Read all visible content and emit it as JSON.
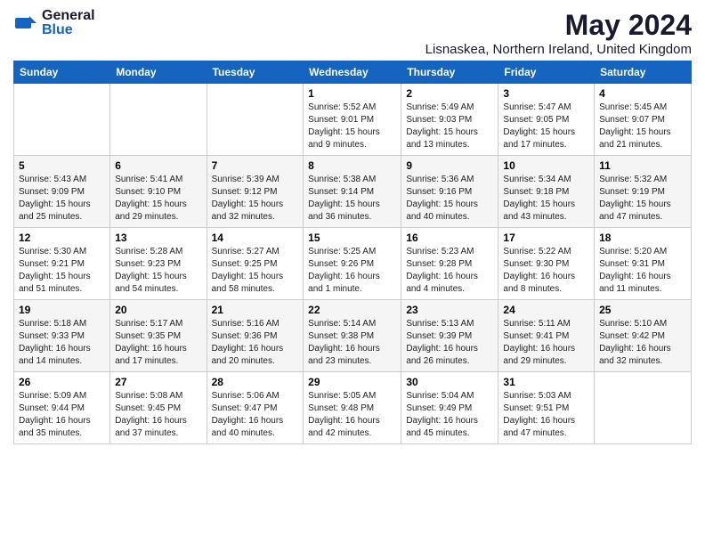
{
  "logo": {
    "general": "General",
    "blue": "Blue"
  },
  "title": "May 2024",
  "location": "Lisnaskea, Northern Ireland, United Kingdom",
  "headers": [
    "Sunday",
    "Monday",
    "Tuesday",
    "Wednesday",
    "Thursday",
    "Friday",
    "Saturday"
  ],
  "weeks": [
    [
      {
        "day": "",
        "info": ""
      },
      {
        "day": "",
        "info": ""
      },
      {
        "day": "",
        "info": ""
      },
      {
        "day": "1",
        "info": "Sunrise: 5:52 AM\nSunset: 9:01 PM\nDaylight: 15 hours\nand 9 minutes."
      },
      {
        "day": "2",
        "info": "Sunrise: 5:49 AM\nSunset: 9:03 PM\nDaylight: 15 hours\nand 13 minutes."
      },
      {
        "day": "3",
        "info": "Sunrise: 5:47 AM\nSunset: 9:05 PM\nDaylight: 15 hours\nand 17 minutes."
      },
      {
        "day": "4",
        "info": "Sunrise: 5:45 AM\nSunset: 9:07 PM\nDaylight: 15 hours\nand 21 minutes."
      }
    ],
    [
      {
        "day": "5",
        "info": "Sunrise: 5:43 AM\nSunset: 9:09 PM\nDaylight: 15 hours\nand 25 minutes."
      },
      {
        "day": "6",
        "info": "Sunrise: 5:41 AM\nSunset: 9:10 PM\nDaylight: 15 hours\nand 29 minutes."
      },
      {
        "day": "7",
        "info": "Sunrise: 5:39 AM\nSunset: 9:12 PM\nDaylight: 15 hours\nand 32 minutes."
      },
      {
        "day": "8",
        "info": "Sunrise: 5:38 AM\nSunset: 9:14 PM\nDaylight: 15 hours\nand 36 minutes."
      },
      {
        "day": "9",
        "info": "Sunrise: 5:36 AM\nSunset: 9:16 PM\nDaylight: 15 hours\nand 40 minutes."
      },
      {
        "day": "10",
        "info": "Sunrise: 5:34 AM\nSunset: 9:18 PM\nDaylight: 15 hours\nand 43 minutes."
      },
      {
        "day": "11",
        "info": "Sunrise: 5:32 AM\nSunset: 9:19 PM\nDaylight: 15 hours\nand 47 minutes."
      }
    ],
    [
      {
        "day": "12",
        "info": "Sunrise: 5:30 AM\nSunset: 9:21 PM\nDaylight: 15 hours\nand 51 minutes."
      },
      {
        "day": "13",
        "info": "Sunrise: 5:28 AM\nSunset: 9:23 PM\nDaylight: 15 hours\nand 54 minutes."
      },
      {
        "day": "14",
        "info": "Sunrise: 5:27 AM\nSunset: 9:25 PM\nDaylight: 15 hours\nand 58 minutes."
      },
      {
        "day": "15",
        "info": "Sunrise: 5:25 AM\nSunset: 9:26 PM\nDaylight: 16 hours\nand 1 minute."
      },
      {
        "day": "16",
        "info": "Sunrise: 5:23 AM\nSunset: 9:28 PM\nDaylight: 16 hours\nand 4 minutes."
      },
      {
        "day": "17",
        "info": "Sunrise: 5:22 AM\nSunset: 9:30 PM\nDaylight: 16 hours\nand 8 minutes."
      },
      {
        "day": "18",
        "info": "Sunrise: 5:20 AM\nSunset: 9:31 PM\nDaylight: 16 hours\nand 11 minutes."
      }
    ],
    [
      {
        "day": "19",
        "info": "Sunrise: 5:18 AM\nSunset: 9:33 PM\nDaylight: 16 hours\nand 14 minutes."
      },
      {
        "day": "20",
        "info": "Sunrise: 5:17 AM\nSunset: 9:35 PM\nDaylight: 16 hours\nand 17 minutes."
      },
      {
        "day": "21",
        "info": "Sunrise: 5:16 AM\nSunset: 9:36 PM\nDaylight: 16 hours\nand 20 minutes."
      },
      {
        "day": "22",
        "info": "Sunrise: 5:14 AM\nSunset: 9:38 PM\nDaylight: 16 hours\nand 23 minutes."
      },
      {
        "day": "23",
        "info": "Sunrise: 5:13 AM\nSunset: 9:39 PM\nDaylight: 16 hours\nand 26 minutes."
      },
      {
        "day": "24",
        "info": "Sunrise: 5:11 AM\nSunset: 9:41 PM\nDaylight: 16 hours\nand 29 minutes."
      },
      {
        "day": "25",
        "info": "Sunrise: 5:10 AM\nSunset: 9:42 PM\nDaylight: 16 hours\nand 32 minutes."
      }
    ],
    [
      {
        "day": "26",
        "info": "Sunrise: 5:09 AM\nSunset: 9:44 PM\nDaylight: 16 hours\nand 35 minutes."
      },
      {
        "day": "27",
        "info": "Sunrise: 5:08 AM\nSunset: 9:45 PM\nDaylight: 16 hours\nand 37 minutes."
      },
      {
        "day": "28",
        "info": "Sunrise: 5:06 AM\nSunset: 9:47 PM\nDaylight: 16 hours\nand 40 minutes."
      },
      {
        "day": "29",
        "info": "Sunrise: 5:05 AM\nSunset: 9:48 PM\nDaylight: 16 hours\nand 42 minutes."
      },
      {
        "day": "30",
        "info": "Sunrise: 5:04 AM\nSunset: 9:49 PM\nDaylight: 16 hours\nand 45 minutes."
      },
      {
        "day": "31",
        "info": "Sunrise: 5:03 AM\nSunset: 9:51 PM\nDaylight: 16 hours\nand 47 minutes."
      },
      {
        "day": "",
        "info": ""
      }
    ]
  ]
}
